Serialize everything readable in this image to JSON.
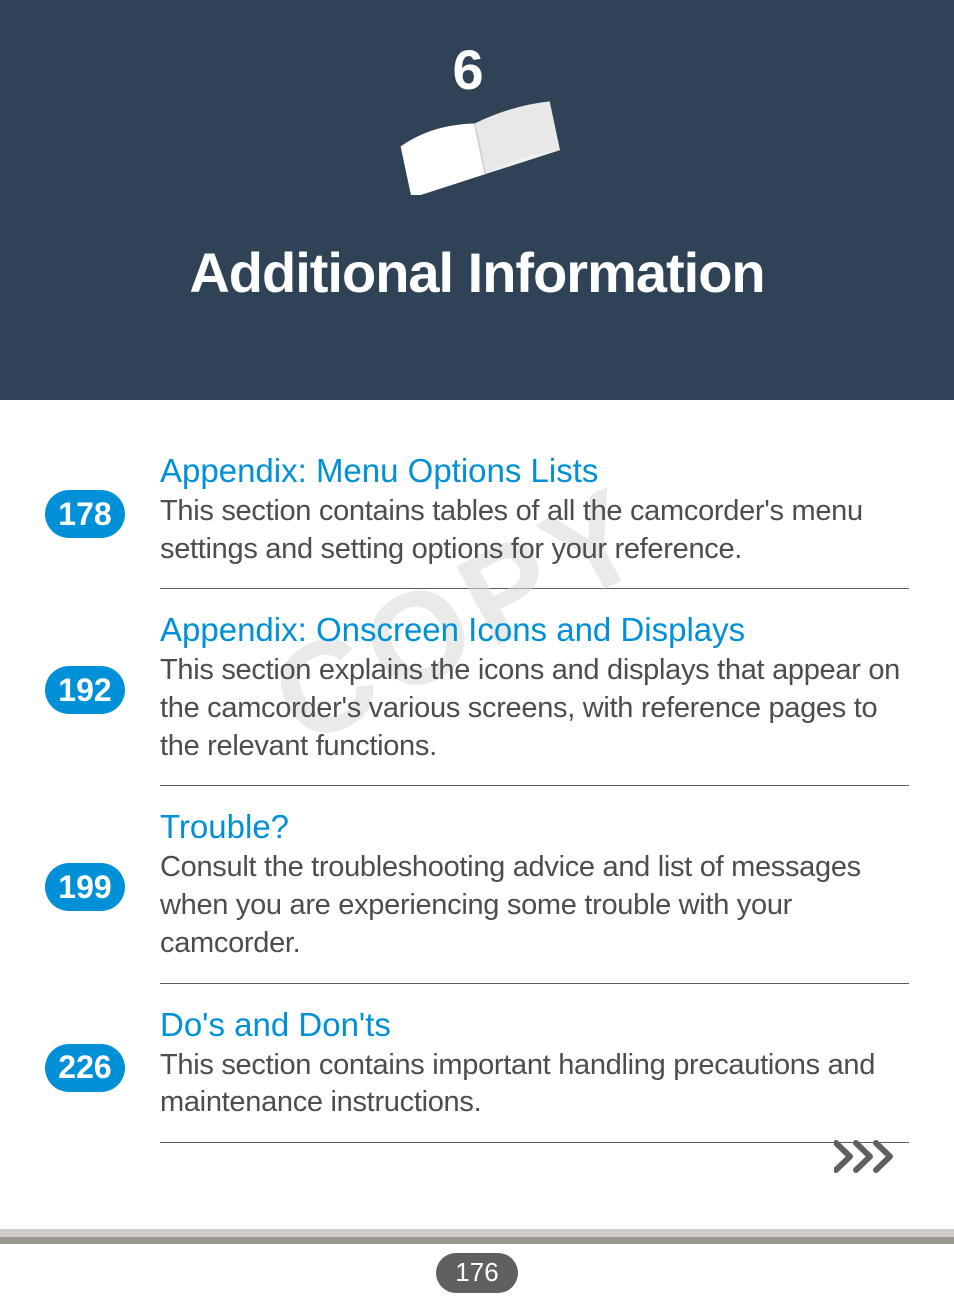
{
  "header": {
    "chapter_number": "6",
    "title": "Additional Information"
  },
  "watermark": "COPY",
  "sections": [
    {
      "page": "178",
      "title": "Appendix: Menu Options Lists",
      "desc": "This section contains tables of all the camcorder's menu settings and setting options for your reference."
    },
    {
      "page": "192",
      "title": "Appendix: Onscreen Icons and Displays",
      "desc": "This section explains the icons and displays that appear on the camcorder's various screens, with reference pages to the relevant functions."
    },
    {
      "page": "199",
      "title": "Trouble?",
      "desc": "Consult the troubleshooting advice and list of messages when you are experiencing some trouble with your camcorder."
    },
    {
      "page": "226",
      "title": "Do's and Don'ts",
      "desc": "This section contains important handling precautions and maintenance instructions."
    }
  ],
  "footer": {
    "page_number": "176"
  }
}
